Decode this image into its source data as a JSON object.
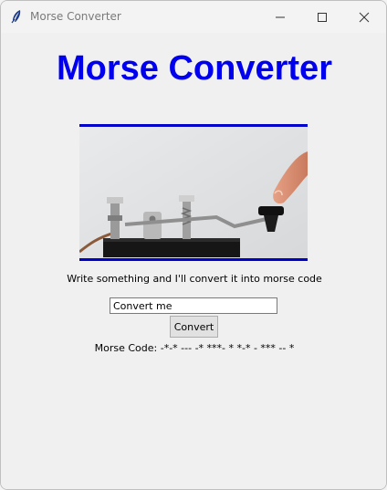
{
  "window": {
    "title": "Morse Converter",
    "controls": {
      "minimize_icon": "minimize-icon",
      "maximize_icon": "maximize-icon",
      "close_icon": "close-icon"
    }
  },
  "main": {
    "heading": "Morse Converter",
    "heading_color": "#0000ee",
    "image_icon": "telegraph-key-photo",
    "instruction": "Write something and I'll convert it into morse code",
    "input_value": "Convert me",
    "convert_label": "Convert",
    "result_text": "Morse Code: -*-* --- -* ***- * *-* - *** -- *"
  }
}
